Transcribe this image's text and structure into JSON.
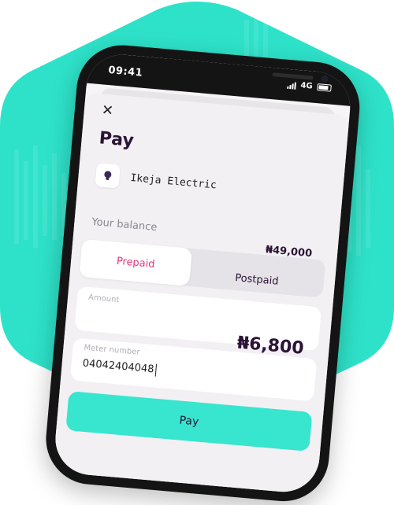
{
  "status": {
    "time": "09:41",
    "network": "4G"
  },
  "pay": {
    "title": "Pay",
    "biller": "Ikeja Electric",
    "balance_label": "Your balance",
    "balance_value": "₦49,000",
    "tabs": {
      "prepaid": "Prepaid",
      "postpaid": "Postpaid"
    },
    "amount_label": "Amount",
    "amount_value": "₦6,800",
    "meter_label": "Meter number",
    "meter_value": "04042404048",
    "pay_button": "Pay"
  },
  "colors": {
    "accent": "#38e5cf",
    "brand_dark": "#2b1436",
    "prepaid_text": "#e8357a"
  }
}
